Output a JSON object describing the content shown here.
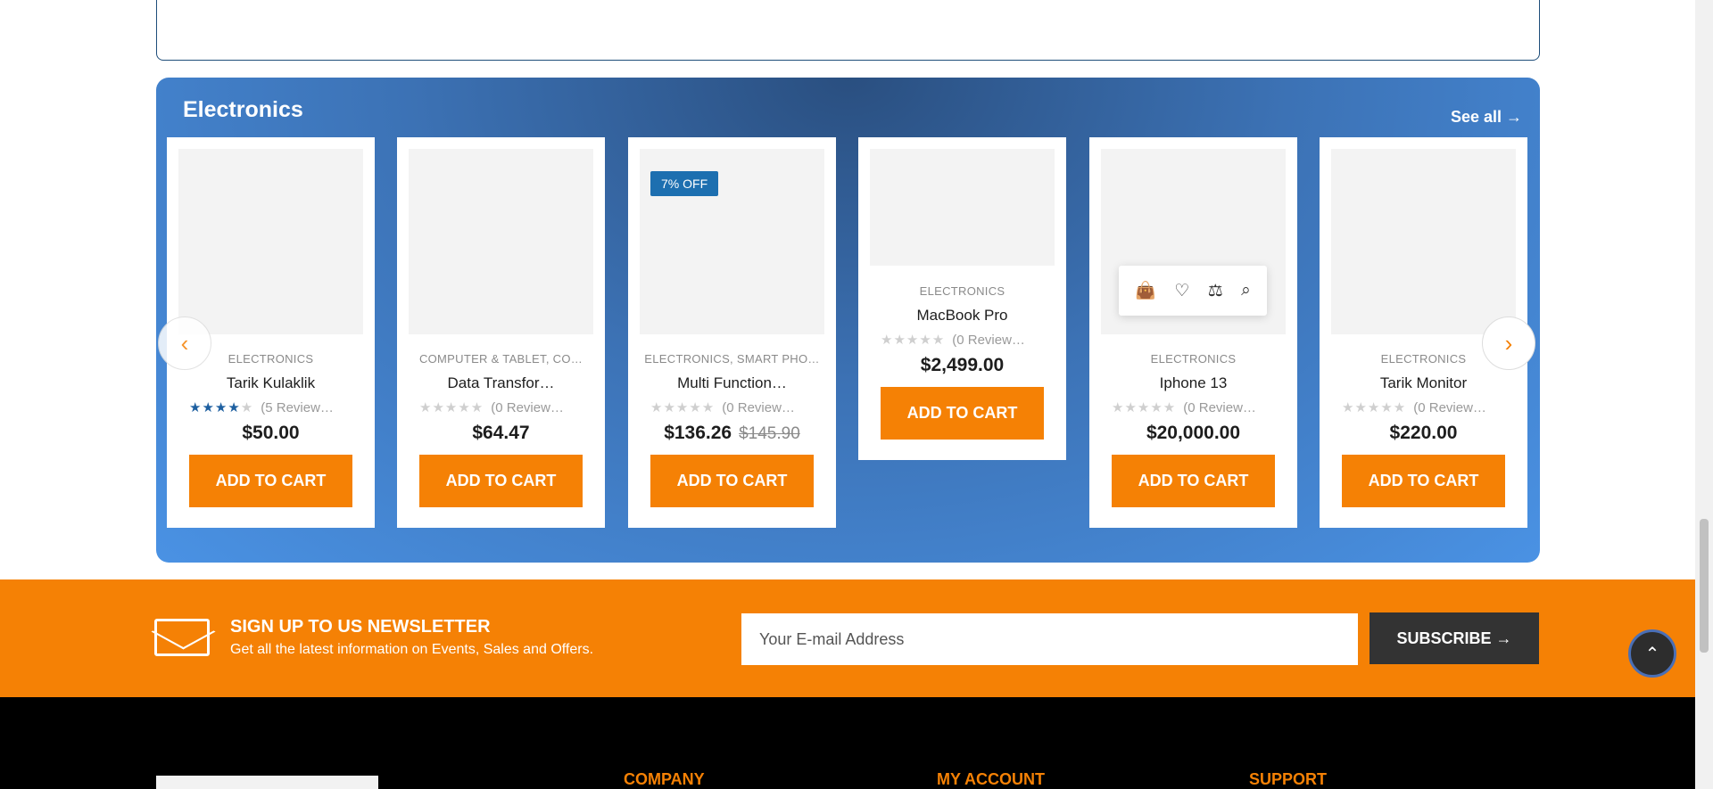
{
  "section": {
    "title": "Electronics",
    "see_all": "See all →"
  },
  "products": [
    {
      "category": "ELECTRONICS",
      "name": "Tarik Kulaklik",
      "stars_on": 4,
      "reviews": "(5 Review…",
      "price": "$50.00",
      "old_price": "",
      "badge": "",
      "cta": "ADD TO CART"
    },
    {
      "category": "COMPUTER & TABLET, CO…",
      "name": "Data Transfor…",
      "stars_on": 0,
      "reviews": "(0 Review…",
      "price": "$64.47",
      "old_price": "",
      "badge": "",
      "cta": "ADD TO CART"
    },
    {
      "category": "ELECTRONICS, SMART PHO…",
      "name": "Multi Function…",
      "stars_on": 0,
      "reviews": "(0 Review…",
      "price": "$136.26",
      "old_price": "$145.90",
      "badge": "7% OFF",
      "cta": "ADD TO CART"
    },
    {
      "category": "ELECTRONICS",
      "name": "MacBook Pro",
      "stars_on": 0,
      "reviews": "(0 Review…",
      "price": "$2,499.00",
      "old_price": "",
      "badge": "",
      "cta": "ADD TO CART"
    },
    {
      "category": "ELECTRONICS",
      "name": "Iphone 13",
      "stars_on": 0,
      "reviews": "(0 Review…",
      "price": "$20,000.00",
      "old_price": "",
      "badge": "",
      "cta": "ADD TO CART"
    },
    {
      "category": "ELECTRONICS",
      "name": "Tarik Monitor",
      "stars_on": 0,
      "reviews": "(0 Review…",
      "price": "$220.00",
      "old_price": "",
      "badge": "",
      "cta": "ADD TO CART"
    }
  ],
  "icons": {
    "prev": "chevron-left-icon",
    "next": "chevron-right-icon",
    "quick_actions": [
      "cart-icon",
      "heart-icon",
      "compare-icon",
      "search-icon"
    ]
  },
  "newsletter": {
    "title": "SIGN UP TO US NEWSLETTER",
    "subtitle": "Get all the latest information on Events, Sales and Offers.",
    "placeholder": "Your E-mail Address",
    "button": "SUBSCRIBE"
  },
  "footer": {
    "col1": "COMPANY",
    "col2": "MY ACCOUNT",
    "col3": "SUPPORT"
  },
  "colors": {
    "accent": "#f58105",
    "star": "#1d5fa0",
    "badge": "#1d6fb0"
  }
}
